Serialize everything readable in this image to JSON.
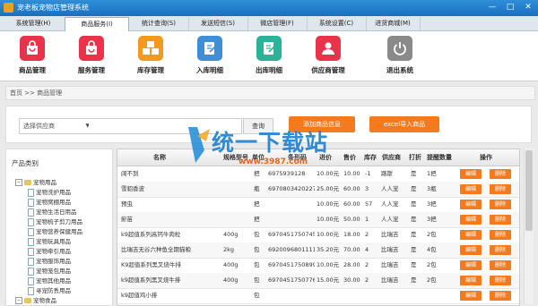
{
  "window": {
    "title": "宠老板宠物店管理系统",
    "minimize": "—",
    "maximize": "□",
    "close": "✕"
  },
  "menu": [
    {
      "label": "系统管理(H)",
      "active": false
    },
    {
      "label": "商品服务(I)",
      "active": true
    },
    {
      "label": "统计查询(S)",
      "active": false
    },
    {
      "label": "发送短信(S)",
      "active": false
    },
    {
      "label": "微店管理(F)",
      "active": false
    },
    {
      "label": "系统设置(C)",
      "active": false
    },
    {
      "label": "进货商城(M)",
      "active": false
    }
  ],
  "toolbar": [
    {
      "label": "商品管理",
      "icon": "shopping-bag-icon",
      "color": "#e8334a"
    },
    {
      "label": "服务管理",
      "icon": "service-bag-icon",
      "color": "#e8334a"
    },
    {
      "label": "库存管理",
      "icon": "boxes-icon",
      "color": "#f39a1e"
    },
    {
      "label": "入库明细",
      "icon": "stock-in-icon",
      "color": "#3f8fd8"
    },
    {
      "label": "出库明细",
      "icon": "stock-out-icon",
      "color": "#2bb39a"
    },
    {
      "label": "供应商管理",
      "icon": "supplier-icon",
      "color": "#e8334a"
    },
    {
      "label": "退出系统",
      "icon": "power-icon",
      "color": "#8a8a8a"
    }
  ],
  "breadcrumb": "首页 >> 商品管理",
  "filter": {
    "supplier_select": "选择供应商",
    "search_value": "",
    "query_label": "查询",
    "add_label": "添加商品信息",
    "excel_label": "excel导入商品"
  },
  "category": {
    "title": "产品类别",
    "tree": [
      {
        "label": "宠物用品",
        "level": 0,
        "type": "folder",
        "expanded": true
      },
      {
        "label": "宠物洗护用品",
        "level": 1,
        "type": "doc"
      },
      {
        "label": "宠物窝棚用品",
        "level": 1,
        "type": "doc"
      },
      {
        "label": "宠物生活日用品",
        "level": 1,
        "type": "doc"
      },
      {
        "label": "宠物梳子剪刀用品",
        "level": 1,
        "type": "doc"
      },
      {
        "label": "宠物营养保健用品",
        "level": 1,
        "type": "doc"
      },
      {
        "label": "宠物玩具用品",
        "level": 1,
        "type": "doc"
      },
      {
        "label": "宠物牵引用品",
        "level": 1,
        "type": "doc"
      },
      {
        "label": "宠物服饰用品",
        "level": 1,
        "type": "doc"
      },
      {
        "label": "宠物笼包用品",
        "level": 1,
        "type": "doc"
      },
      {
        "label": "宠物其他用品",
        "level": 1,
        "type": "doc"
      },
      {
        "label": "寻宠防丢用品",
        "level": 1,
        "type": "doc"
      },
      {
        "label": "宠物食品",
        "level": 0,
        "type": "folder",
        "expanded": true
      }
    ]
  },
  "grid": {
    "columns": [
      "名称",
      "规格型号",
      "单位",
      "条形码",
      "进价",
      "售价",
      "库存",
      "供应商",
      "打折",
      "提醒数量",
      "操作"
    ],
    "edit_label": "编辑",
    "delete_label": "删除",
    "rows": [
      [
        "阔不到",
        "",
        "把",
        "6975939128",
        "10.00元",
        "10.00",
        "-1",
        "路斯",
        "是",
        "1把"
      ],
      [
        "雪貂香波",
        "",
        "瓶",
        "6970803420227",
        "25.00元",
        "60.00",
        "3",
        "人人宠",
        "是",
        "3瓶"
      ],
      [
        "预虫",
        "",
        "把",
        "",
        "10.00元",
        "60.00",
        "57",
        "人人宠",
        "是",
        "3把"
      ],
      [
        "瘀苗",
        "",
        "把",
        "",
        "10.00元",
        "50.00",
        "1",
        "人人宠",
        "是",
        "3把"
      ],
      [
        "k9超值系列高钙牛肉粒",
        "400g",
        "包",
        "6970451750745",
        "10.00元",
        "18.00",
        "2",
        "比瑞吉",
        "是",
        "2包"
      ],
      [
        "比瑞吉无谷六种鱼全期猫粮",
        "2kg",
        "包",
        "6920096801111",
        "35.20元",
        "70.00",
        "4",
        "比瑞吉",
        "是",
        "4包"
      ],
      [
        "K9超值系列黑叉烧牛排",
        "400g",
        "包",
        "6970451750899",
        "10.00元",
        "28.00",
        "2",
        "比瑞吉",
        "是",
        "2包"
      ],
      [
        "k9超值系列黑叉烧牛排",
        "400g",
        "包",
        "6970451750776",
        "15.00元",
        "30.00",
        "2",
        "比瑞吉",
        "是",
        "2包"
      ],
      [
        "k9超值鸡小排",
        "",
        "包",
        "",
        "",
        "",
        "",
        "",
        "",
        ""
      ]
    ]
  },
  "watermark": {
    "main": "统一下载站",
    "sub": "www.3987.com"
  }
}
